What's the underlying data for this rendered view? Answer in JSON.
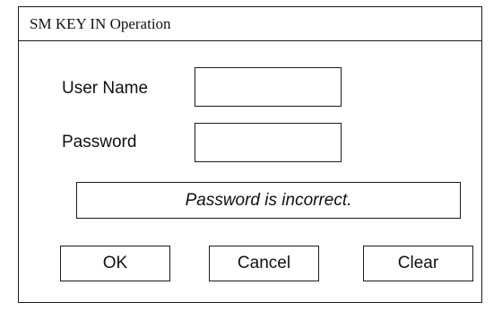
{
  "window": {
    "title": "SM KEY IN Operation"
  },
  "form": {
    "username_label": "User Name",
    "username_value": "",
    "password_label": "Password",
    "password_value": ""
  },
  "message": {
    "text": "Password is incorrect."
  },
  "buttons": {
    "ok_label": "OK",
    "cancel_label": "Cancel",
    "clear_label": "Clear"
  }
}
